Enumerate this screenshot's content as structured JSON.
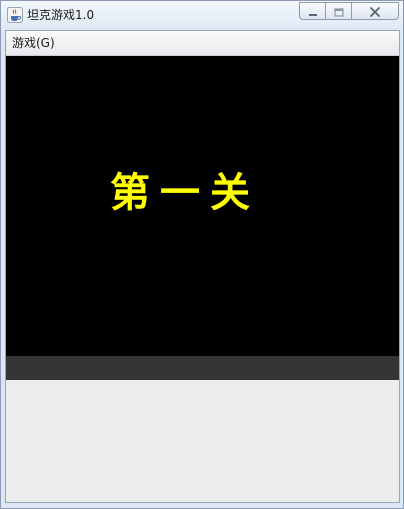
{
  "window": {
    "title": "坦克游戏1.0",
    "icons": {
      "app": "java-cup-icon",
      "minimize": "minimize-icon",
      "maximize": "maximize-icon",
      "close": "close-icon"
    }
  },
  "menubar": {
    "items": [
      {
        "label": "游戏(G)"
      }
    ]
  },
  "game": {
    "stage_text": "第一关",
    "colors": {
      "stage_text": "#ffff00",
      "canvas": "#000000",
      "status_strip": "#353535"
    }
  }
}
